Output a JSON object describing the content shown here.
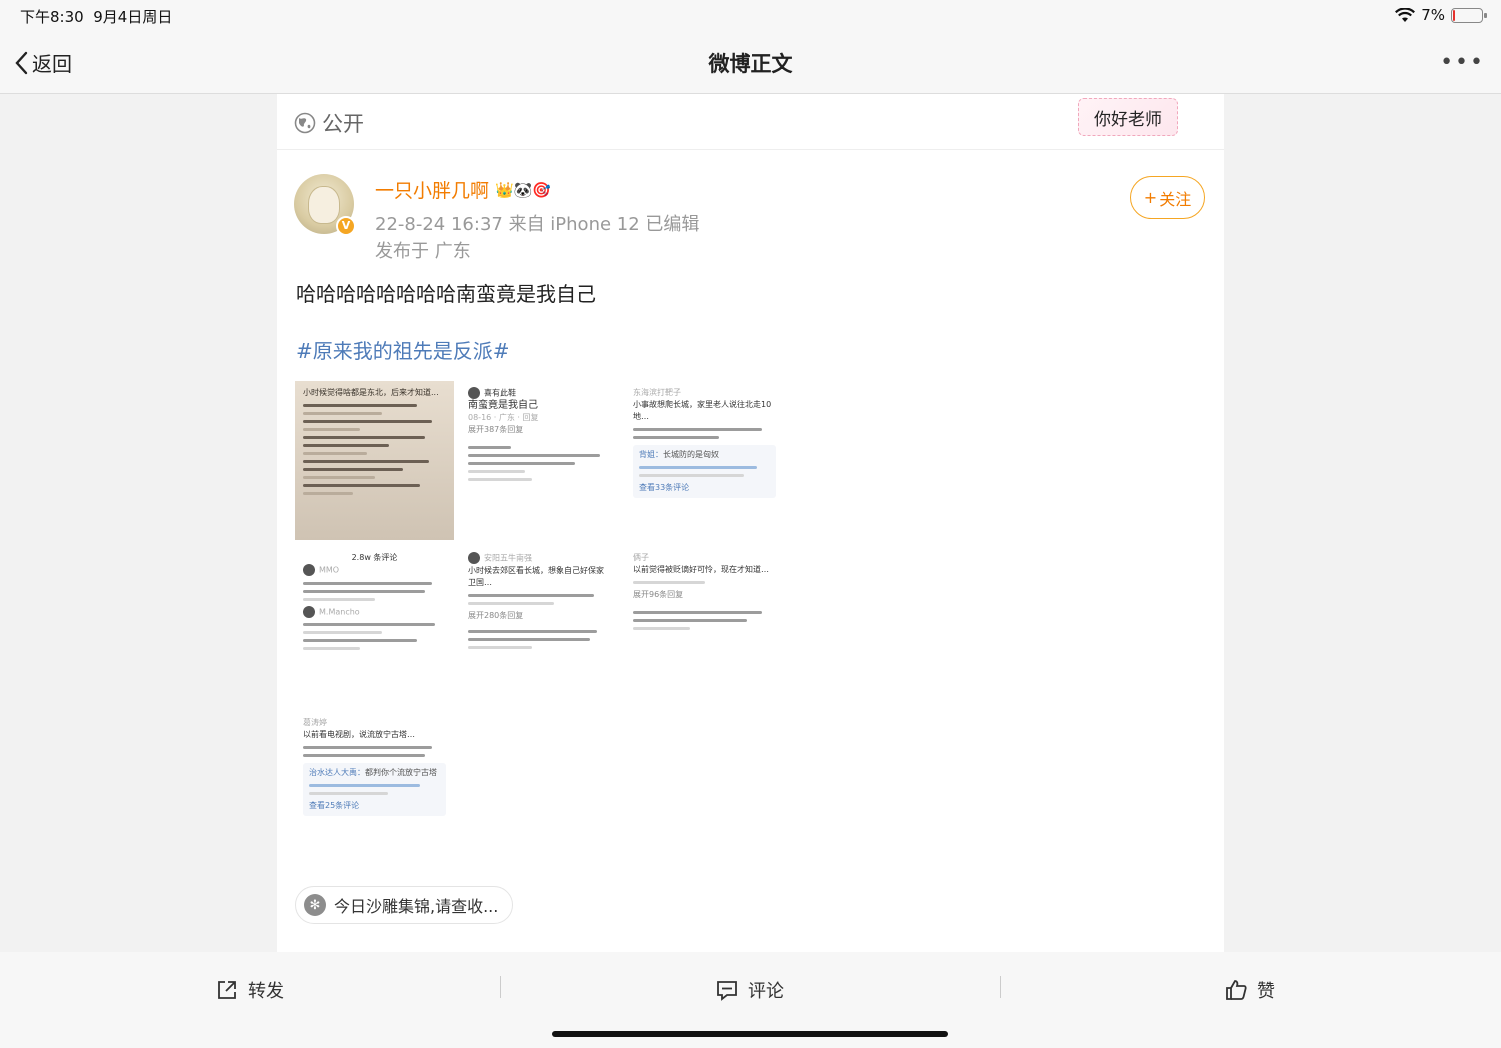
{
  "status_bar": {
    "time": "下午8:30",
    "date": "9月4日周日",
    "battery_percent": "7%",
    "battery_level": 0.07
  },
  "nav": {
    "back_label": "返回",
    "title": "微博正文",
    "more": "•••"
  },
  "post": {
    "visibility": "公开",
    "sticker_text": "你好老师",
    "author": {
      "name": "一只小胖几啊",
      "badges": "👑🐼🎯",
      "verified": "V"
    },
    "meta": "22-8-24 16:37  来自 iPhone 12  已编辑",
    "location": "发布于 广东",
    "follow_label": "关注",
    "follow_plus": "+",
    "text": "哈哈哈哈哈哈哈哈南蛮竟是我自己",
    "topic": "#原来我的祖先是反派#",
    "images": [
      {
        "title": "小时候觉得啥都是东北，后来才知道..."
      },
      {
        "user": "喜有此鞋",
        "title": "南蛮竟是我自己",
        "sub": "08-16 · 广东 · 回复",
        "replies": "展开387条回复"
      },
      {
        "user": "东海滨打靶子",
        "title": "小事故想爬长城，家里老人说往北走10地…",
        "reply_user": "背姐",
        "reply": "长城防的是匈奴",
        "more": "查看33条评论"
      },
      {
        "title": "2.8w 条评论",
        "user": "MMO",
        "reply_user": "M.Mancho"
      },
      {
        "user": "安阳五牛南强",
        "title": "小时候去郊区看长城，想象自己好保家卫国…",
        "replies": "展开280条回复"
      },
      {
        "user": "俩子",
        "title": "以前觉得被贬谪好可怜，现在才知道…",
        "replies": "展开96条回复"
      },
      {
        "user": "葛涛婷",
        "title": "以前看电视剧，说流放宁古塔…",
        "reply_user": "治水达人大禹",
        "reply": "都判你个流放宁古塔",
        "more": "查看25条评论"
      }
    ],
    "collection": "今日沙雕集锦,请查收..."
  },
  "toolbar": {
    "repost": "转发",
    "comment": "评论",
    "like": "赞"
  }
}
